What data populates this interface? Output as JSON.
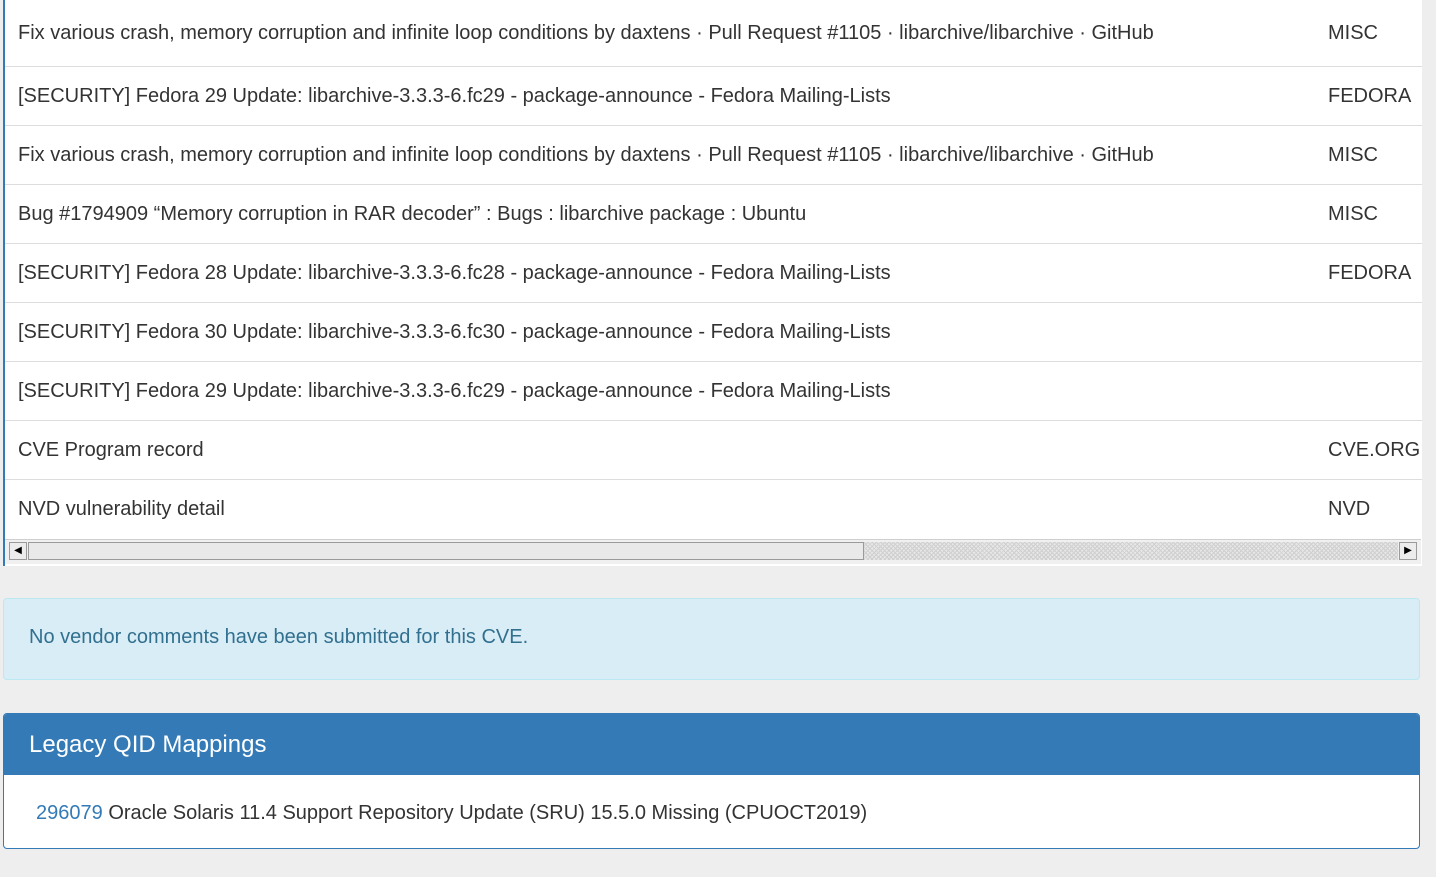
{
  "references": [
    {
      "name": "Fix various crash, memory corruption and infinite loop conditions by daxtens · Pull Request #1105 · libarchive/libarchive · GitHub",
      "source": "MISC"
    },
    {
      "name": "[SECURITY] Fedora 29 Update: libarchive-3.3.3-6.fc29 - package-announce - Fedora Mailing-Lists",
      "source": "FEDORA"
    },
    {
      "name": "Fix various crash, memory corruption and infinite loop conditions by daxtens · Pull Request #1105 · libarchive/libarchive · GitHub",
      "source": "MISC"
    },
    {
      "name": "Bug #1794909 “Memory corruption in RAR decoder” : Bugs : libarchive package : Ubuntu",
      "source": "MISC"
    },
    {
      "name": "[SECURITY] Fedora 28 Update: libarchive-3.3.3-6.fc28 - package-announce - Fedora Mailing-Lists",
      "source": "FEDORA"
    },
    {
      "name": "[SECURITY] Fedora 30 Update: libarchive-3.3.3-6.fc30 - package-announce - Fedora Mailing-Lists",
      "source": ""
    },
    {
      "name": "[SECURITY] Fedora 29 Update: libarchive-3.3.3-6.fc29 - package-announce - Fedora Mailing-Lists",
      "source": ""
    },
    {
      "name": "CVE Program record",
      "source": "CVE.ORG"
    },
    {
      "name": "NVD vulnerability detail",
      "source": "NVD"
    }
  ],
  "scrollbar": {
    "left_arrow": "◀",
    "right_arrow": "▶",
    "position_fraction": 0.61
  },
  "vendor_comments": {
    "text": "No vendor comments have been submitted for this CVE."
  },
  "legacy_qid": {
    "heading": "Legacy QID Mappings",
    "items": [
      {
        "qid": "296079",
        "title": "Oracle Solaris 11.4 Support Repository Update (SRU) 15.5.0 Missing (CPUOCT2019)"
      }
    ]
  },
  "colors": {
    "primary": "#337ab7",
    "info_bg": "#d9edf7",
    "info_text": "#31708f",
    "page_bg": "#eeeeee"
  }
}
